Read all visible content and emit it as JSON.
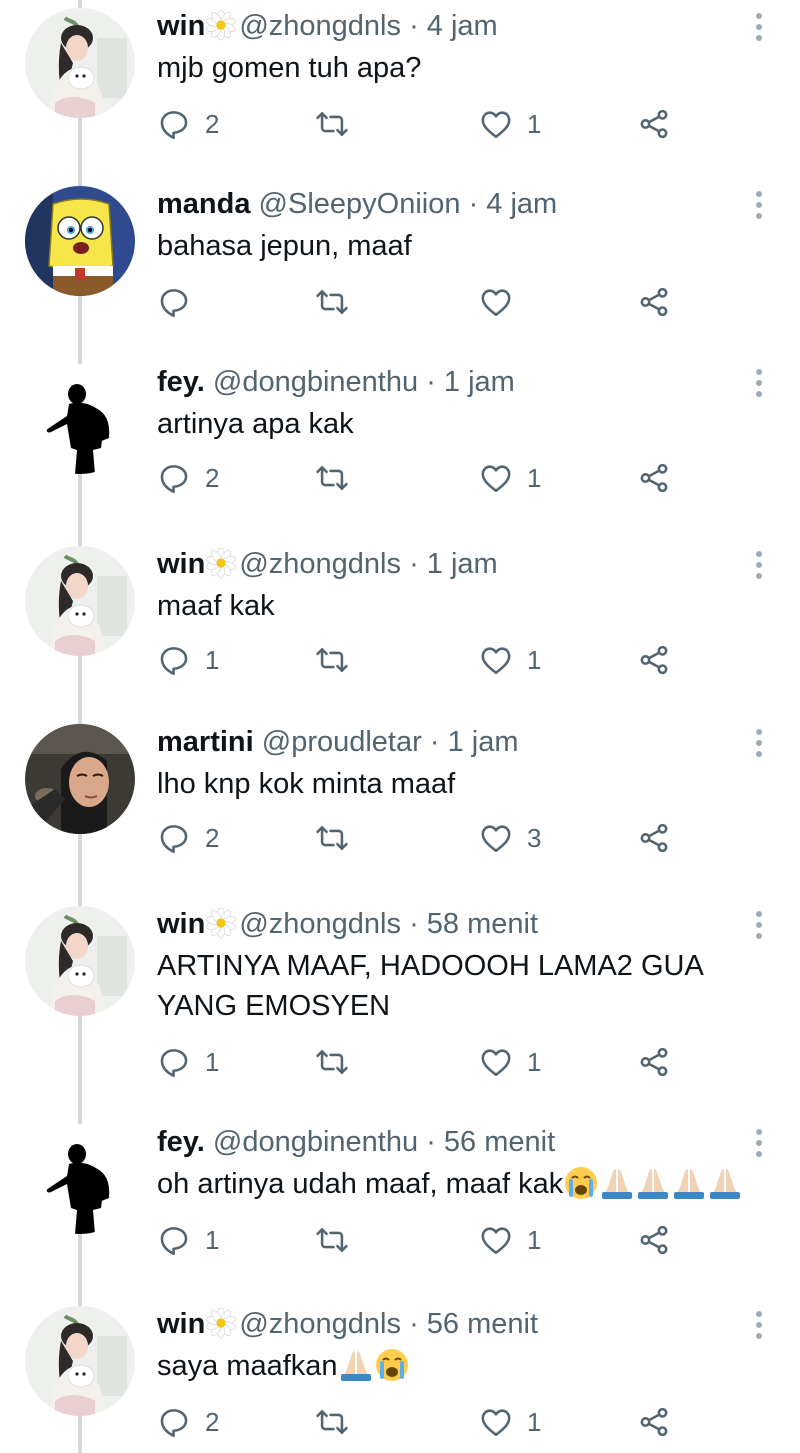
{
  "tweets": [
    {
      "name": "win",
      "flower": true,
      "handle": "@zhongdnls",
      "time": "4 jam",
      "text": "mjb gomen tuh apa?",
      "emoji": [],
      "replies": "2",
      "retweets": "",
      "likes": "1",
      "avatar": "win"
    },
    {
      "name": "manda",
      "flower": false,
      "handle": "@SleepyOniion",
      "time": "4 jam",
      "text": "bahasa jepun, maaf",
      "emoji": [],
      "replies": "",
      "retweets": "",
      "likes": "",
      "avatar": "manda"
    },
    {
      "name": "fey.",
      "flower": false,
      "handle": "@dongbinenthu",
      "time": "1 jam",
      "text": "artinya apa kak",
      "emoji": [],
      "replies": "2",
      "retweets": "",
      "likes": "1",
      "avatar": "fey"
    },
    {
      "name": "win",
      "flower": true,
      "handle": "@zhongdnls",
      "time": "1 jam",
      "text": "maaf kak",
      "emoji": [],
      "replies": "1",
      "retweets": "",
      "likes": "1",
      "avatar": "win"
    },
    {
      "name": "martini",
      "flower": false,
      "handle": "@proudletar",
      "time": "1 jam",
      "text": "lho knp kok minta maaf",
      "emoji": [],
      "replies": "2",
      "retweets": "",
      "likes": "3",
      "avatar": "martini"
    },
    {
      "name": "win",
      "flower": true,
      "handle": "@zhongdnls",
      "time": "58 menit",
      "text": "ARTINYA MAAF, HADOOOH LAMA2 GUA YANG EMOSYEN",
      "emoji": [],
      "replies": "1",
      "retweets": "",
      "likes": "1",
      "avatar": "win"
    },
    {
      "name": "fey.",
      "flower": false,
      "handle": "@dongbinenthu",
      "time": "56 menit",
      "text": "oh artinya udah maaf, maaf kak",
      "emoji": [
        "crying-face",
        "folded-hands",
        "folded-hands",
        "folded-hands",
        "folded-hands"
      ],
      "replies": "1",
      "retweets": "",
      "likes": "1",
      "avatar": "fey"
    },
    {
      "name": "win",
      "flower": true,
      "handle": "@zhongdnls",
      "time": "56 menit",
      "text": "saya maafkan",
      "emoji": [
        "folded-hands",
        "crying-face"
      ],
      "replies": "2",
      "retweets": "",
      "likes": "1",
      "avatar": "win"
    }
  ],
  "separator": "·",
  "icons": {
    "reply": "reply-icon",
    "retweet": "retweet-icon",
    "like": "heart-icon",
    "share": "share-icon",
    "more": "more-options-icon",
    "flower": "flower-emoji-icon"
  },
  "colors": {
    "text": "#0f1419",
    "secondary": "#536471",
    "thread_line": "#cfd9de",
    "icon": "#536471"
  }
}
